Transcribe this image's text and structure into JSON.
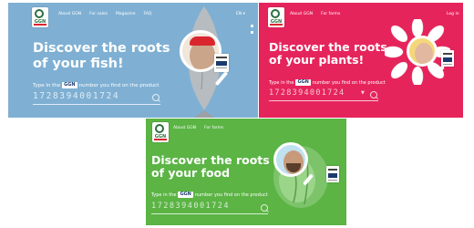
{
  "panels": {
    "fish": {
      "bg": "#7fb0d3",
      "logo_text": "GGN",
      "nav": [
        "About GGN",
        "For sales",
        "Magazine",
        "FAQ"
      ],
      "top_right": "EN ▾",
      "headline": [
        "Discover the roots",
        "of your fish!"
      ],
      "prompt_before": "Type in the",
      "badge": "GGN",
      "prompt_after": "number you find on the product",
      "code": "1728394001724",
      "illustration": "fish-with-man-magnifier"
    },
    "plants": {
      "bg": "#e6245c",
      "logo_text": "GGN",
      "nav": [
        "About GGN",
        "For farms"
      ],
      "top_right": "Log in",
      "headline": [
        "Discover the roots",
        "of your plants!"
      ],
      "prompt_before": "Type in the",
      "badge": "GGN",
      "prompt_after": "number you find on the product",
      "code": "1728394001724",
      "illustration": "daisy-with-man-magnifier"
    },
    "food": {
      "bg": "#5bb444",
      "logo_text": "GGN",
      "nav": [
        "About GGN",
        "For farms"
      ],
      "headline": [
        "Discover the roots",
        "of your food"
      ],
      "prompt_before": "Type in the",
      "badge": "GGN",
      "prompt_after": "number you find on the product",
      "code": "1728394001724",
      "illustration": "salad-with-man-magnifier"
    }
  }
}
